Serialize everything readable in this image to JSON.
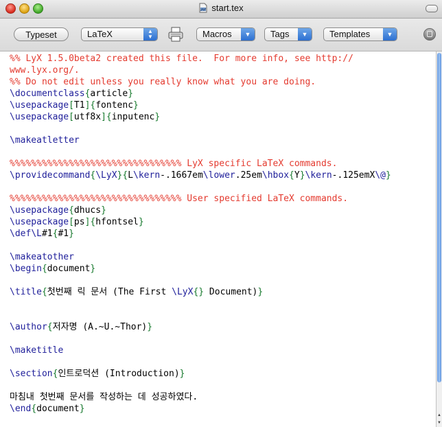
{
  "window": {
    "title": "start.tex"
  },
  "toolbar": {
    "typeset_label": "Typeset",
    "engine_selected": "LaTeX",
    "macros_label": "Macros",
    "tags_label": "Tags",
    "templates_label": "Templates"
  },
  "editor": {
    "lines": [
      [
        {
          "t": "%% LyX 1.5.0beta2 created this file.  For more info, see http://",
          "s": "c"
        }
      ],
      [
        {
          "t": "www.lyx.org/.",
          "s": "c"
        }
      ],
      [
        {
          "t": "%% Do not edit unless you really know what you are doing.",
          "s": "c"
        }
      ],
      [
        {
          "t": "\\documentclass",
          "s": "k"
        },
        {
          "t": "{",
          "s": "b"
        },
        {
          "t": "article",
          "s": ""
        },
        {
          "t": "}",
          "s": "b"
        }
      ],
      [
        {
          "t": "\\usepackage",
          "s": "k"
        },
        {
          "t": "[",
          "s": "b"
        },
        {
          "t": "T1",
          "s": ""
        },
        {
          "t": "]{",
          "s": "b"
        },
        {
          "t": "fontenc",
          "s": ""
        },
        {
          "t": "}",
          "s": "b"
        }
      ],
      [
        {
          "t": "\\usepackage",
          "s": "k"
        },
        {
          "t": "[",
          "s": "b"
        },
        {
          "t": "utf8x",
          "s": ""
        },
        {
          "t": "]{",
          "s": "b"
        },
        {
          "t": "inputenc",
          "s": ""
        },
        {
          "t": "}",
          "s": "b"
        }
      ],
      [],
      [
        {
          "t": "\\makeatletter",
          "s": "k"
        }
      ],
      [],
      [
        {
          "t": "%%%%%%%%%%%%%%%%%%%%%%%%%%%%%%%% LyX specific LaTeX commands.",
          "s": "c"
        }
      ],
      [
        {
          "t": "\\providecommand",
          "s": "k"
        },
        {
          "t": "{",
          "s": "b"
        },
        {
          "t": "\\LyX",
          "s": "k"
        },
        {
          "t": "}{",
          "s": "b"
        },
        {
          "t": "L",
          "s": ""
        },
        {
          "t": "\\kern",
          "s": "k"
        },
        {
          "t": "-.1667em",
          "s": ""
        },
        {
          "t": "\\lower",
          "s": "k"
        },
        {
          "t": ".25em",
          "s": ""
        },
        {
          "t": "\\hbox",
          "s": "k"
        },
        {
          "t": "{",
          "s": "b"
        },
        {
          "t": "Y",
          "s": ""
        },
        {
          "t": "}",
          "s": "b"
        },
        {
          "t": "\\kern",
          "s": "k"
        },
        {
          "t": "-.125emX",
          "s": ""
        },
        {
          "t": "\\@",
          "s": "k"
        },
        {
          "t": "}",
          "s": "b"
        }
      ],
      [],
      [
        {
          "t": "%%%%%%%%%%%%%%%%%%%%%%%%%%%%%%%% User specified LaTeX commands.",
          "s": "c"
        }
      ],
      [
        {
          "t": "\\usepackage",
          "s": "k"
        },
        {
          "t": "{",
          "s": "b"
        },
        {
          "t": "dhucs",
          "s": ""
        },
        {
          "t": "}",
          "s": "b"
        }
      ],
      [
        {
          "t": "\\usepackage",
          "s": "k"
        },
        {
          "t": "[",
          "s": "b"
        },
        {
          "t": "ps",
          "s": ""
        },
        {
          "t": "]{",
          "s": "b"
        },
        {
          "t": "hfontsel",
          "s": ""
        },
        {
          "t": "}",
          "s": "b"
        }
      ],
      [
        {
          "t": "\\def",
          "s": "k"
        },
        {
          "t": "\\L",
          "s": "k"
        },
        {
          "t": "#1",
          "s": ""
        },
        {
          "t": "{",
          "s": "b"
        },
        {
          "t": "#1",
          "s": ""
        },
        {
          "t": "}",
          "s": "b"
        }
      ],
      [],
      [
        {
          "t": "\\makeatother",
          "s": "k"
        }
      ],
      [
        {
          "t": "\\begin",
          "s": "k"
        },
        {
          "t": "{",
          "s": "b"
        },
        {
          "t": "document",
          "s": ""
        },
        {
          "t": "}",
          "s": "b"
        }
      ],
      [],
      [
        {
          "t": "\\title",
          "s": "k"
        },
        {
          "t": "{",
          "s": "b"
        },
        {
          "t": "첫번째 릭 문서 (The First ",
          "s": ""
        },
        {
          "t": "\\LyX",
          "s": "k"
        },
        {
          "t": "{}",
          "s": "b"
        },
        {
          "t": " Document)",
          "s": ""
        },
        {
          "t": "}",
          "s": "b"
        }
      ],
      [],
      [],
      [
        {
          "t": "\\author",
          "s": "k"
        },
        {
          "t": "{",
          "s": "b"
        },
        {
          "t": "저자명 (A.~U.~Thor)",
          "s": ""
        },
        {
          "t": "}",
          "s": "b"
        }
      ],
      [],
      [
        {
          "t": "\\maketitle",
          "s": "k"
        }
      ],
      [],
      [
        {
          "t": "\\section",
          "s": "k"
        },
        {
          "t": "{",
          "s": "b"
        },
        {
          "t": "인트로덕션 (Introduction)",
          "s": ""
        },
        {
          "t": "}",
          "s": "b"
        }
      ],
      [],
      [
        {
          "t": "마침내 첫번째 문서를 작성하는 데 성공하였다.",
          "s": ""
        }
      ],
      [
        {
          "t": "\\end",
          "s": "k"
        },
        {
          "t": "{",
          "s": "b"
        },
        {
          "t": "document",
          "s": ""
        },
        {
          "t": "}",
          "s": "b"
        }
      ]
    ]
  },
  "colors": {
    "comment": "#e43a2f",
    "command": "#1e1e9a",
    "brace": "#187a2e",
    "popup_arrow": "#2c6fd1"
  },
  "icons": {
    "document": "document-icon",
    "printer": "printer-icon",
    "toolbar_toggle": "toolbar-toggle-icon"
  }
}
